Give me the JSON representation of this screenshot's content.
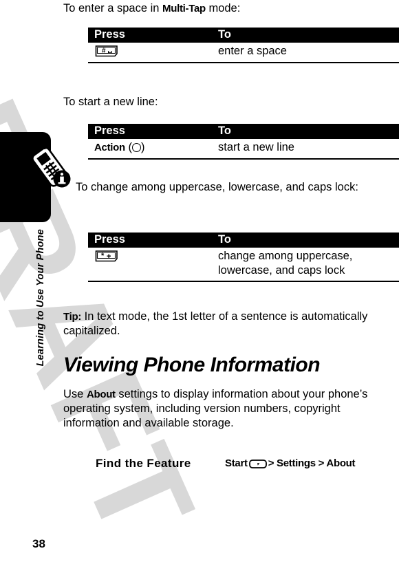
{
  "watermark": {
    "text": "DRAFT"
  },
  "sidebar": {
    "chapter_title": "Learning to Use Your Phone",
    "tab_icon": "phone-info-icon"
  },
  "intro": {
    "space_prompt_before": "To enter a space in ",
    "space_prompt_bold": "Multi-Tap",
    "space_prompt_after": " mode:",
    "newline_prompt": "To start a new line:",
    "case_prompt": "To change among uppercase, lowercase, and caps lock:"
  },
  "tables": [
    {
      "id": "space-table",
      "headers": {
        "press": "Press",
        "to": "To"
      },
      "rows": [
        {
          "press_icon": "pound-key-icon",
          "press_label": "",
          "to": "enter a space"
        }
      ]
    },
    {
      "id": "newline-table",
      "headers": {
        "press": "Press",
        "to": "To"
      },
      "rows": [
        {
          "press_icon": "action-circle-key-icon",
          "press_label": "Action",
          "press_suffix": "(○)",
          "to": "start a new line"
        }
      ]
    },
    {
      "id": "case-table",
      "headers": {
        "press": "Press",
        "to": "To"
      },
      "rows": [
        {
          "press_icon": "star-key-icon",
          "press_label": "",
          "to": "change among uppercase, lowercase, and caps lock"
        }
      ]
    }
  ],
  "tip": {
    "label": "Tip:",
    "text": " In text mode, the 1st letter of a sentence is automatically capitalized."
  },
  "section": {
    "heading": "Viewing Phone Information",
    "body_before": "Use ",
    "body_bold": "About",
    "body_after": " settings to display information about your phone’s operating system, including version numbers, copyright information and available storage."
  },
  "find_feature": {
    "label": "Find the Feature",
    "path_start": "Start",
    "path_rest": "> Settings > About"
  },
  "footer": {
    "page_number": "38"
  },
  "colors": {
    "ink": "#000000",
    "paper": "#ffffff",
    "watermark": "#d8d8d8"
  }
}
